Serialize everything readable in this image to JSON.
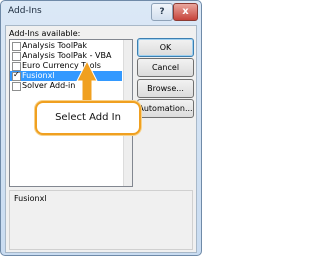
{
  "window": {
    "title": "Add-Ins",
    "help_label": "?",
    "close_label": "x"
  },
  "addins": {
    "list_label": "Add-Ins available:",
    "items": [
      {
        "label": "Analysis ToolPak",
        "checked": false,
        "selected": false
      },
      {
        "label": "Analysis ToolPak - VBA",
        "checked": false,
        "selected": false
      },
      {
        "label": "Euro Currency Tools",
        "checked": false,
        "selected": false
      },
      {
        "label": "Fusionxl",
        "checked": true,
        "selected": true
      },
      {
        "label": "Solver Add-in",
        "checked": false,
        "selected": false
      }
    ],
    "check_glyph": "✓"
  },
  "buttons": {
    "ok": "OK",
    "cancel": "Cancel",
    "browse": "Browse...",
    "automation": "Automation..."
  },
  "description": {
    "name": "Fusionxl"
  },
  "annotation": {
    "callout_text": "Select Add In",
    "accent_color": "#f0a020"
  },
  "colors": {
    "selection": "#3399ff"
  }
}
